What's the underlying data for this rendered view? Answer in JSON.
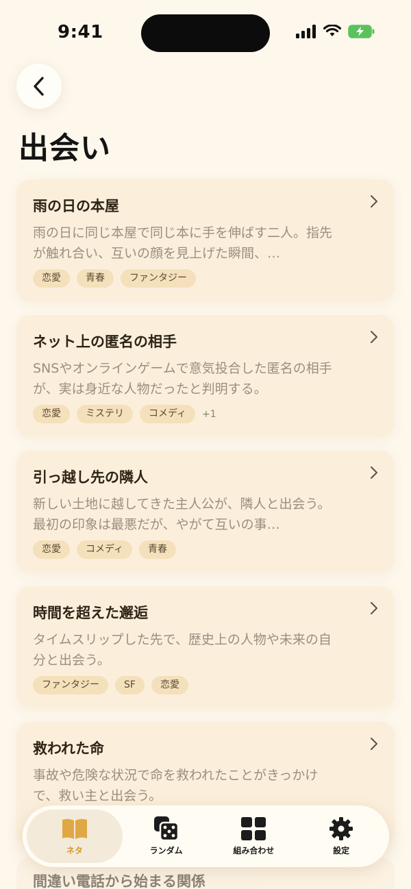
{
  "status": {
    "time": "9:41"
  },
  "page": {
    "title": "出会い"
  },
  "cards": [
    {
      "title": "雨の日の本屋",
      "description": "雨の日に同じ本屋で同じ本に手を伸ばす二人。指先が触れ合い、互いの顔を見上げた瞬間、…",
      "tags": [
        "恋愛",
        "青春",
        "ファンタジー"
      ],
      "more": ""
    },
    {
      "title": "ネット上の匿名の相手",
      "description": "SNSやオンラインゲームで意気投合した匿名の相手が、実は身近な人物だったと判明する。",
      "tags": [
        "恋愛",
        "ミステリ",
        "コメディ"
      ],
      "more": "+1"
    },
    {
      "title": "引っ越し先の隣人",
      "description": "新しい土地に越してきた主人公が、隣人と出会う。最初の印象は最悪だが、やがて互いの事…",
      "tags": [
        "恋愛",
        "コメディ",
        "青春"
      ],
      "more": ""
    },
    {
      "title": "時間を超えた邂逅",
      "description": "タイムスリップした先で、歴史上の人物や未来の自分と出会う。",
      "tags": [
        "ファンタジー",
        "SF",
        "恋愛"
      ],
      "more": ""
    },
    {
      "title": "救われた命",
      "description": "事故や危険な状況で命を救われたことがきっかけで、救い主と出会う。",
      "tags": [],
      "more": ""
    }
  ],
  "peek_card": {
    "title": "間違い電話から始まる関係"
  },
  "tabs": [
    {
      "label": "ネタ",
      "icon": "book-icon",
      "active": true
    },
    {
      "label": "ランダム",
      "icon": "dice-icon",
      "active": false
    },
    {
      "label": "組み合わせ",
      "icon": "grid-icon",
      "active": false
    },
    {
      "label": "設定",
      "icon": "gear-icon",
      "active": false
    }
  ],
  "colors": {
    "accent": "#d39a2c",
    "card_bg": "#fbefdc",
    "tag_bg": "#f4e0bb",
    "page_bg": "#fdf7ec"
  }
}
